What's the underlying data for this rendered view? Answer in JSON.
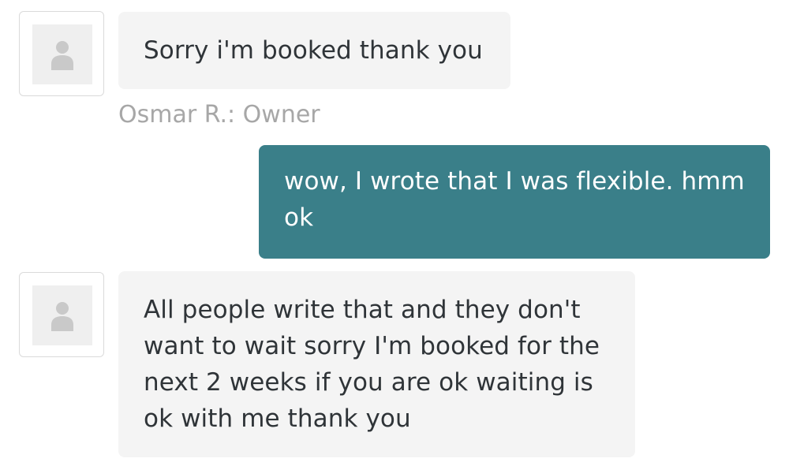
{
  "conversation": {
    "messages": [
      {
        "direction": "incoming",
        "avatar_icon": "user-placeholder-icon",
        "text": "Sorry i'm booked thank you"
      },
      {
        "direction": "outgoing",
        "text": "wow, I wrote that I was flexible. hmm\nok"
      },
      {
        "direction": "incoming",
        "avatar_icon": "user-placeholder-icon",
        "text": "All people write that and they don't\nwant to wait sorry I'm booked for the\nnext 2 weeks if you are ok waiting is\nok with me thank you"
      }
    ],
    "sender_label": "Osmar R.: Owner"
  },
  "colors": {
    "outgoing_bubble": "#3a7f89",
    "incoming_bubble": "#f4f4f4",
    "sender_label": "#a7a7a7"
  }
}
